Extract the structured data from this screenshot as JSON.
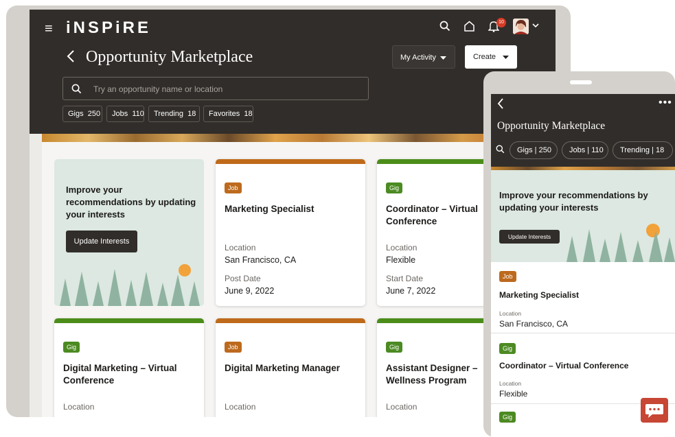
{
  "app": {
    "logo": "iNSPiRE",
    "notification_count": "10"
  },
  "page": {
    "title": "Opportunity Marketplace"
  },
  "actions": {
    "my_activity": "My Activity",
    "create": "Create"
  },
  "search": {
    "placeholder": "Try an opportunity name or location"
  },
  "filters": [
    {
      "label": "Gigs",
      "count": "250"
    },
    {
      "label": "Jobs",
      "count": "110"
    },
    {
      "label": "Trending",
      "count": "18"
    },
    {
      "label": "Favorites",
      "count": "18"
    }
  ],
  "promo": {
    "text": "Improve your recommendations by updating your interests",
    "button": "Update Interests"
  },
  "cards": [
    {
      "type": "Job",
      "title": "Marketing Specialist",
      "field1_label": "Location",
      "field1_value": "San Francisco, CA",
      "field2_label": "Post Date",
      "field2_value": "June 9, 2022"
    },
    {
      "type": "Gig",
      "title": "Coordinator – Virtual Conference",
      "field1_label": "Location",
      "field1_value": "Flexible",
      "field2_label": "Start Date",
      "field2_value": "June 7, 2022"
    },
    {
      "type": "Gig",
      "title": "Digital Marketing – Virtual Conference",
      "field1_label": "Location"
    },
    {
      "type": "Job",
      "title": "Digital Marketing Manager",
      "field1_label": "Location"
    },
    {
      "type": "Gig",
      "title": "Assistant Designer – Wellness Program",
      "field1_label": "Location"
    }
  ],
  "mobile": {
    "title": "Opportunity Marketplace",
    "chips": [
      {
        "label": "Gigs",
        "count": "250"
      },
      {
        "label": "Jobs",
        "count": "110"
      },
      {
        "label": "Trending",
        "count": "18"
      }
    ],
    "promo": {
      "text": "Improve your recommendations by updating your interests",
      "button": "Update Interests"
    },
    "items": [
      {
        "type": "Job",
        "title": "Marketing Specialist",
        "label": "Location",
        "value": "San Francisco, CA"
      },
      {
        "type": "Gig",
        "title": "Coordinator – Virtual Conference",
        "label": "Location",
        "value": "Flexible"
      },
      {
        "type": "Gig"
      }
    ]
  },
  "colors": {
    "header": "#312d2a",
    "job": "#bf6a1a",
    "gig": "#4c8d1a",
    "chat": "#c74634"
  }
}
